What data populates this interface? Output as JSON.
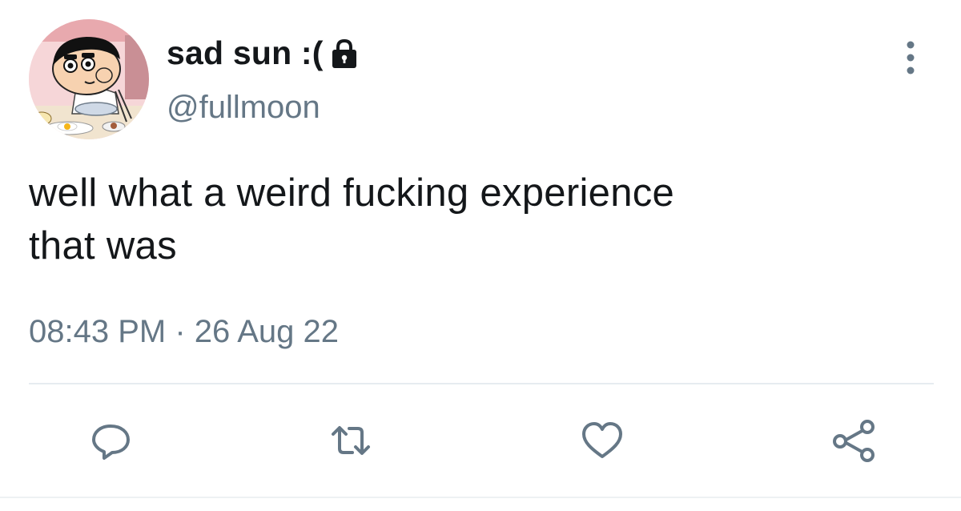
{
  "user": {
    "display_name": "sad sun :(",
    "handle": "@fullmoon",
    "avatar_icon": "cartoon-boy-eating-avatar",
    "protected_icon": "lock-icon"
  },
  "tweet": {
    "text": "well what a weird fucking experience\nthat was",
    "time": "08:43 PM",
    "separator": "·",
    "date": "26 Aug 22"
  },
  "actions": {
    "reply_icon": "reply-icon",
    "retweet_icon": "retweet-icon",
    "like_icon": "heart-icon",
    "share_icon": "share-icon",
    "more_icon": "more-options-icon"
  },
  "colors": {
    "primary_text": "#14171a",
    "secondary_text": "#657786",
    "divider": "#e6ecf0",
    "icon": "#657786"
  }
}
